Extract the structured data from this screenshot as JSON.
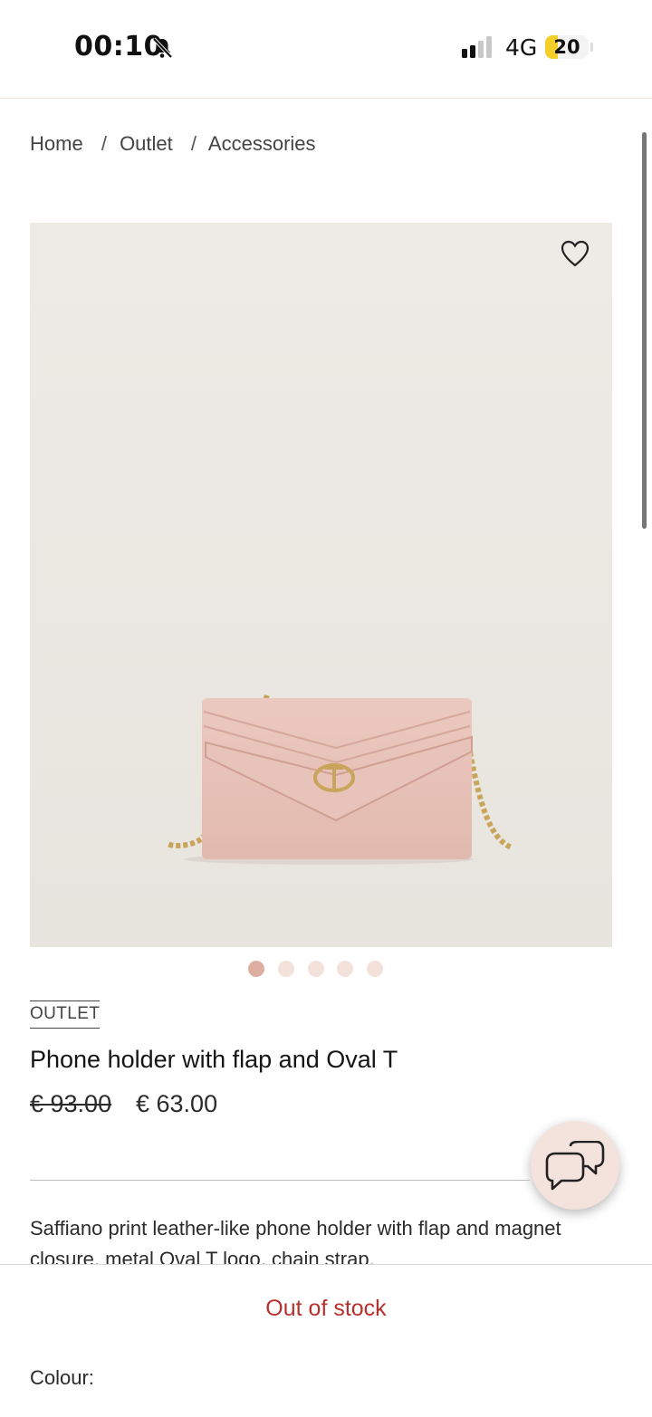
{
  "status_bar": {
    "time": "00:10",
    "network": "4G",
    "battery": "20",
    "icons": [
      "bell-slash-icon",
      "signal-icon",
      "battery-icon"
    ]
  },
  "breadcrumb": {
    "items": [
      "Home",
      "Outlet",
      "Accessories"
    ],
    "separator": "/"
  },
  "gallery": {
    "image_alt": "pink envelope phone holder with gold chain strap and Oval T logo",
    "slides": 5,
    "active_slide": 1,
    "wishlist_icon": "heart-icon"
  },
  "product": {
    "tag": "OUTLET",
    "title": "Phone holder with flap and Oval T",
    "price_old": "€ 93.00",
    "price_new": "€ 63.00",
    "description": "Saffiano print leather-like phone holder with flap and magnet closure, metal Oval T logo, chain strap."
  },
  "chat": {
    "icon": "chat-bubbles-icon"
  },
  "bottom": {
    "availability": "Out of stock",
    "colour_label": "Colour:"
  },
  "colors": {
    "accent_red": "#b7312e",
    "dot_active": "#deaea1",
    "dot_inactive": "#f4e1da",
    "chat_bg": "#f4e3dd"
  }
}
